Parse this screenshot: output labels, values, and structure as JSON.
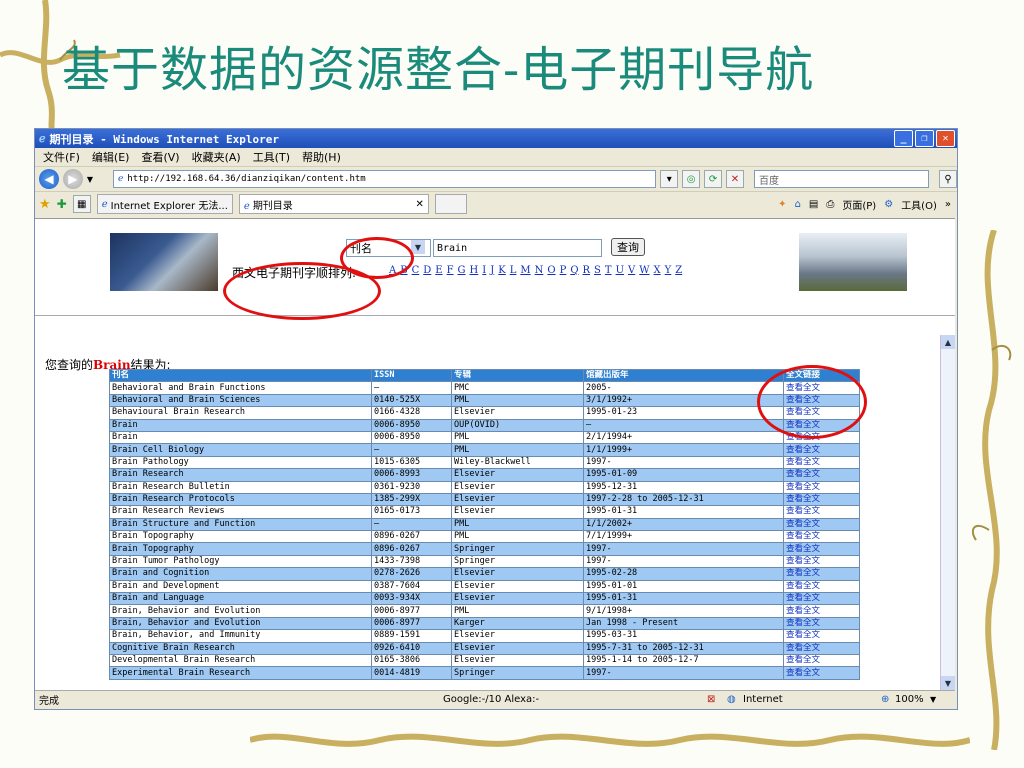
{
  "slide": {
    "title": "基于数据的资源整合-电子期刊导航"
  },
  "browser": {
    "title": "期刊目录 - Windows Internet Explorer",
    "menu": [
      "文件(F)",
      "编辑(E)",
      "查看(V)",
      "收藏夹(A)",
      "工具(T)",
      "帮助(H)"
    ],
    "address": "http://192.168.64.36/dianziqikan/content.htm",
    "search_placeholder": "百度",
    "tabs": [
      {
        "label": "Internet Explorer 无法..."
      },
      {
        "label": "期刊目录"
      }
    ],
    "toolbar_right": [
      "页面(P)",
      "工具(O)"
    ],
    "status": {
      "left": "完成",
      "center": "Google:-/10  Alexa:-",
      "zone": "Internet",
      "zoom": "100%"
    }
  },
  "search": {
    "field_option": "刊名",
    "query": "Brain",
    "button": "查询",
    "alpha_label": "西文电子期刊字顺排列:",
    "letters": [
      "A",
      "B",
      "C",
      "D",
      "E",
      "F",
      "G",
      "H",
      "I",
      "J",
      "K",
      "L",
      "M",
      "N",
      "O",
      "P",
      "Q",
      "R",
      "S",
      "T",
      "U",
      "V",
      "W",
      "X",
      "Y",
      "Z"
    ]
  },
  "results": {
    "prefix": "您查询的",
    "keyword": "Brain",
    "suffix": "结果为:",
    "headers": [
      "刊名",
      "ISSN",
      "专辑",
      "馆藏出版年",
      "全文链接"
    ],
    "rows": [
      [
        "Behavioral and Brain Functions",
        "—",
        "PMC",
        "2005-",
        "查看全文"
      ],
      [
        "Behavioral and Brain Sciences",
        "0140-525X",
        "PML",
        "3/1/1992+",
        "查看全文"
      ],
      [
        "Behavioural Brain Research",
        "0166-4328",
        "Elsevier",
        "1995-01-23",
        "查看全文"
      ],
      [
        "Brain",
        "0006-8950",
        "OUP(OVID)",
        "—",
        "查看全文"
      ],
      [
        "Brain",
        "0006-8950",
        "PML",
        "2/1/1994+",
        "查看全文"
      ],
      [
        "Brain Cell Biology",
        "—",
        "PML",
        "1/1/1999+",
        "查看全文"
      ],
      [
        "Brain Pathology",
        "1015-6305",
        "Wiley-Blackwell",
        "1997-",
        "查看全文"
      ],
      [
        "Brain Research",
        "0006-8993",
        "Elsevier",
        "1995-01-09",
        "查看全文"
      ],
      [
        "Brain Research Bulletin",
        "0361-9230",
        "Elsevier",
        "1995-12-31",
        "查看全文"
      ],
      [
        "Brain Research Protocols",
        "1385-299X",
        "Elsevier",
        "1997-2-28 to 2005-12-31",
        "查看全文"
      ],
      [
        "Brain Research Reviews",
        "0165-0173",
        "Elsevier",
        "1995-01-31",
        "查看全文"
      ],
      [
        "Brain Structure and Function",
        "—",
        "PML",
        "1/1/2002+",
        "查看全文"
      ],
      [
        "Brain Topography",
        "0896-0267",
        "PML",
        "7/1/1999+",
        "查看全文"
      ],
      [
        "Brain Topography",
        "0896-0267",
        "Springer",
        "1997-",
        "查看全文"
      ],
      [
        "Brain Tumor Pathology",
        "1433-7398",
        "Springer",
        "1997-",
        "查看全文"
      ],
      [
        "Brain and Cognition",
        "0278-2626",
        "Elsevier",
        "1995-02-28",
        "查看全文"
      ],
      [
        "Brain and Development",
        "0387-7604",
        "Elsevier",
        "1995-01-01",
        "查看全文"
      ],
      [
        "Brain and Language",
        "0093-934X",
        "Elsevier",
        "1995-01-31",
        "查看全文"
      ],
      [
        "Brain, Behavior and Evolution",
        "0006-8977",
        "PML",
        "9/1/1998+",
        "查看全文"
      ],
      [
        "Brain, Behavior and Evolution",
        "0006-8977",
        "Karger",
        "Jan 1998 - Present",
        "查看全文"
      ],
      [
        "Brain, Behavior, and Immunity",
        "0889-1591",
        "Elsevier",
        "1995-03-31",
        "查看全文"
      ],
      [
        "Cognitive Brain Research",
        "0926-6410",
        "Elsevier",
        "1995-7-31 to 2005-12-31",
        "查看全文"
      ],
      [
        "Developmental Brain Research",
        "0165-3806",
        "Elsevier",
        "1995-1-14 to 2005-12-7",
        "查看全文"
      ],
      [
        "Experimental Brain Research",
        "0014-4819",
        "Springer",
        "1997-",
        "查看全文"
      ]
    ]
  },
  "colors": {
    "header_bg": "#2f80d0",
    "row_alt": "#9fc8f2",
    "highlight": "#e01010",
    "title": "#1a8a7a"
  }
}
